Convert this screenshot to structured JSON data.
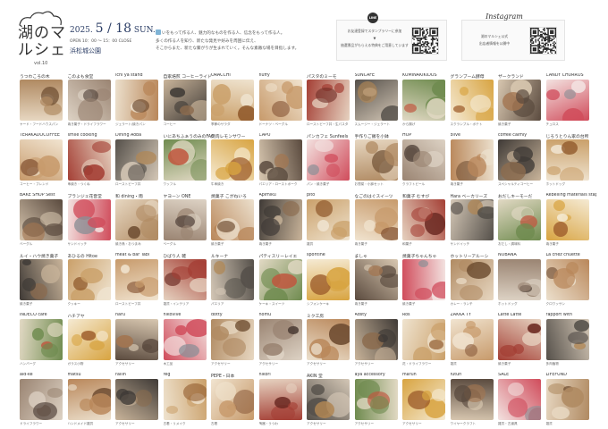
{
  "header": {
    "logo_text": "湖のマルシェ",
    "volume": "vol.10",
    "date_year": "2025.",
    "date_month_day": "5 / 18",
    "date_weekday": "SUN.",
    "time": "OPEN 10：00 ～ 15：00 CLOSE",
    "place": "浜松城公園",
    "lead_lines": [
      "いをもって作る人、魅力的なものを作る人、信念をもって作る人。",
      "多くの作る人を知り、新たな発見や好みを周囲に伝え、",
      "そこからまた、新たな繋がりが生まれていく。そんな素敵な場を目指します。"
    ],
    "line_qr": {
      "title": "LINE",
      "desc_lines": [
        "お友達登録でスタンプラリーに参加",
        "▼",
        "抽選景品がもらえる特典をご用意しています"
      ]
    },
    "instagram_qr": {
      "title": "Instagram",
      "desc_lines": [
        "湖のマルシェ公式",
        "出店者情報を公開中"
      ]
    }
  },
  "vendors": [
    {
      "name": "うつわころの木",
      "caption": "ヤード・フードハウスパン"
    },
    {
      "name": "このよも食堂",
      "caption": "焼き菓子・ドライフラワー"
    },
    {
      "name": "ichi ya stand",
      "caption": "ジェラート/焼きパン"
    },
    {
      "name": "自家焙煎 コーヒーライド",
      "caption": "コーヒー"
    },
    {
      "name": "ORACCHI",
      "caption": "季節のサラダ"
    },
    {
      "name": "fluffy",
      "caption": "ドーナツ・ベーグル"
    },
    {
      "name": "パスタのミーモ",
      "caption": "ローストビーフ丼・生パスタ"
    },
    {
      "name": "SUNCAFE",
      "caption": "スムージー・ジェラート"
    },
    {
      "name": "KUMINAKIKIDOS",
      "caption": "から揚げ"
    },
    {
      "name": "グランブーム酵母",
      "caption": "スクランブル・ポテト"
    },
    {
      "name": "ザークランド",
      "caption": "焼き菓子"
    },
    {
      "name": "CANDY CHURROS",
      "caption": "チュロス"
    },
    {
      "name": "TERAKADOCOFFEE",
      "caption": "コーヒー・ブレンド"
    },
    {
      "name": "smile cooking",
      "caption": "串焼き・つくね"
    },
    {
      "name": "Dining Aoba",
      "caption": "ローストビーフ丼"
    },
    {
      "name": "いにあちふぁうのみのFACTORY",
      "caption": "ワッフル"
    },
    {
      "name": "焼肉レモンサワー",
      "caption": "牛串焼き"
    },
    {
      "name": "CAPU",
      "caption": "パエリア・ローストポーク"
    },
    {
      "name": "パンカフェ Sunfeels",
      "caption": "パン・焼き菓子"
    },
    {
      "name": "手作りご飯を小鉢",
      "caption": "お惣菜・小鉢セット"
    },
    {
      "name": "HOP",
      "caption": "クラフトビール"
    },
    {
      "name": "olive",
      "caption": "焼き菓子"
    },
    {
      "name": "coffee calmly",
      "caption": "スペシャルティコーヒー"
    },
    {
      "name": "じろうとりん家の台所",
      "caption": "ホットドッグ"
    },
    {
      "name": "BAKE SHOP Sest",
      "caption": "ベーグル"
    },
    {
      "name": "ブランジェ花音堂",
      "caption": "サンドイッチ"
    },
    {
      "name": "和 dining・雨",
      "caption": "焼き鳥・おつまみ"
    },
    {
      "name": "ヤヨーン ONE",
      "caption": "ベーグル"
    },
    {
      "name": "焼菓子 こがねいろ",
      "caption": "焼き菓子"
    },
    {
      "name": "Apimiku",
      "caption": "焼き菓子"
    },
    {
      "name": "pito",
      "caption": "雑貨"
    },
    {
      "name": "なごのはぐスイーツ",
      "caption": "焼き菓子"
    },
    {
      "name": "和菓子 むすび",
      "caption": "和菓子"
    },
    {
      "name": "Hara ベーカリーズ",
      "caption": "サンドイッチ"
    },
    {
      "name": "おだしキーモーだ",
      "caption": "おだし・調味料"
    },
    {
      "name": "Rebelling materials staples",
      "caption": "焼き菓子"
    },
    {
      "name": "ルイ・ハウ焼き菓子",
      "caption": "焼き菓子"
    },
    {
      "name": "あひるの Hitoe",
      "caption": "クッキー"
    },
    {
      "name": "meat & bar Tabi",
      "caption": "ローストビーフ丼"
    },
    {
      "name": "ひばり人 雑",
      "caption": "雑貨・インテリア"
    },
    {
      "name": "ルキーナ",
      "caption": "パエリア"
    },
    {
      "name": "パティスリーレイエ",
      "caption": "ケーキ・スイーツ"
    },
    {
      "name": "spontine",
      "caption": "シフォンケーキ"
    },
    {
      "name": "ましゃ",
      "caption": "焼き菓子"
    },
    {
      "name": "焼菓子ちゃんちゃ",
      "caption": "焼き菓子"
    },
    {
      "name": "ホットリーアルーシ",
      "caption": "カレー・ランチ"
    },
    {
      "name": "NOBANA",
      "caption": "ホットドッグ"
    },
    {
      "name": "La chez chuette",
      "caption": "クロワッサン"
    },
    {
      "name": "INDECO cafe",
      "caption": "ハンバーグ"
    },
    {
      "name": "ハチアヤ",
      "caption": "ガラス小物"
    },
    {
      "name": "haru",
      "caption": "アクセサリー"
    },
    {
      "name": "nikovive",
      "caption": "木工品"
    },
    {
      "name": "dotty",
      "caption": "アクセサリー"
    },
    {
      "name": "nomu",
      "caption": "アクセサリー"
    },
    {
      "name": "ミク工房",
      "caption": "アクセサリー"
    },
    {
      "name": "Adsty",
      "caption": "アクセサリー"
    },
    {
      "name": "Ros",
      "caption": "花・ドライフラワー"
    },
    {
      "name": "ZAKKA TY",
      "caption": "雑貨"
    },
    {
      "name": "Latte Latte",
      "caption": "焼き菓子"
    },
    {
      "name": "rapport with",
      "caption": "多肉植物"
    },
    {
      "name": "aid-ke",
      "caption": "ドライフラワー"
    },
    {
      "name": "matsu",
      "caption": "ハンドメイド雑貨"
    },
    {
      "name": "railin",
      "caption": "アクセサリー"
    },
    {
      "name": "reg",
      "caption": "古着・リメイク"
    },
    {
      "name": "PEPE・日本",
      "caption": "古着"
    },
    {
      "name": "nikori",
      "caption": "陶器・うつわ"
    },
    {
      "name": "AKIN 堂",
      "caption": "アクセサリー"
    },
    {
      "name": "aya accessory",
      "caption": "アクセサリー"
    },
    {
      "name": "marun",
      "caption": "アクセサリー"
    },
    {
      "name": "futuri",
      "caption": "ワイヤークラフト"
    },
    {
      "name": "SALE",
      "caption": "雑貨・古道具"
    },
    {
      "name": "LIFEFUND",
      "caption": "雑貨"
    }
  ]
}
